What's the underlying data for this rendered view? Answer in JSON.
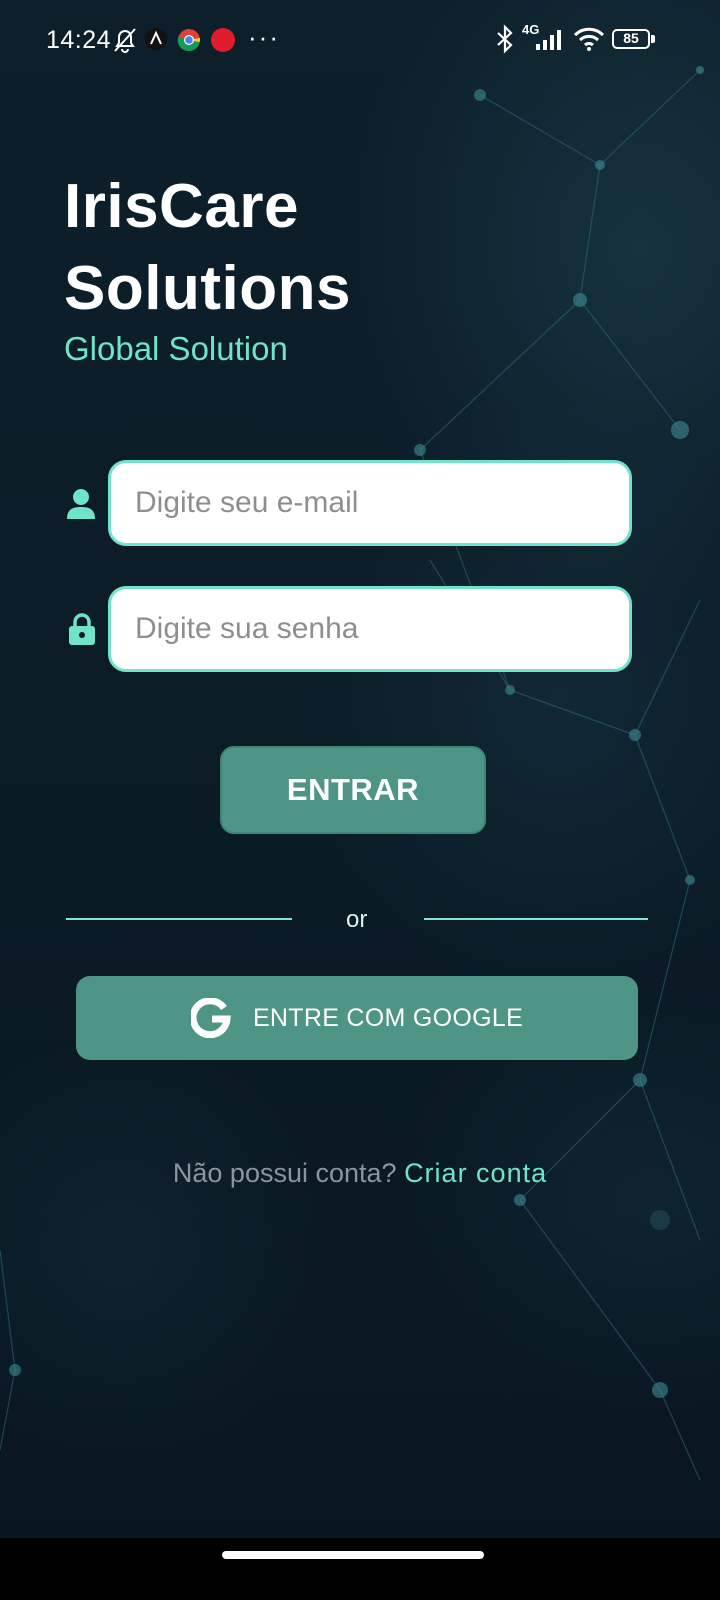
{
  "status_bar": {
    "time": "14:24",
    "network": "4G",
    "battery": "85",
    "more": "···",
    "icons": [
      "bell-off-icon",
      "app-icon",
      "chrome-icon",
      "app-red-icon",
      "bluetooth-icon",
      "signal-icon",
      "wifi-icon",
      "battery-icon"
    ]
  },
  "app": {
    "title_line1": "IrisCare",
    "title_line2": "Solutions",
    "subtitle": "Global Solution"
  },
  "form": {
    "email_placeholder": "Digite seu e-mail",
    "password_placeholder": "Digite sua senha",
    "submit_label": "ENTRAR",
    "divider_text": "or",
    "google_label": "ENTRE COM GOOGLE"
  },
  "signup": {
    "question": "Não possui conta?",
    "link": "Criar conta"
  },
  "colors": {
    "background": "#0b1a24",
    "accent": "#6fe4c8",
    "button": "#4e9585"
  }
}
